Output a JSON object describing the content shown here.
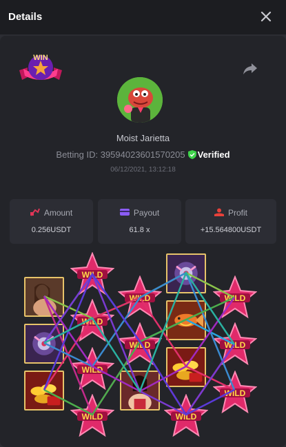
{
  "header": {
    "title": "Details"
  },
  "win_badge": "WIN",
  "player": {
    "name": "Moist Jarietta",
    "betting_id": "Betting ID: 39594023601570205",
    "verified": "Verified",
    "datetime": "06/12/2021, 13:12:18"
  },
  "stats": {
    "amount": {
      "label": "Amount",
      "value": "0.256USDT"
    },
    "payout": {
      "label": "Payout",
      "value": "61.8 x"
    },
    "profit": {
      "label": "Profit",
      "value": "+15.564800USDT"
    }
  },
  "wild_label": "WILD",
  "colors": {
    "accent_green": "#3ed34a",
    "stat_amount": "#e03557",
    "stat_payout": "#8b5cf6",
    "stat_profit": "#e8413a",
    "frame_gold": "#e8c46a"
  },
  "icons": [
    "close-icon",
    "share-icon",
    "verified-shield-icon",
    "amount-icon",
    "payout-icon",
    "profit-icon"
  ]
}
